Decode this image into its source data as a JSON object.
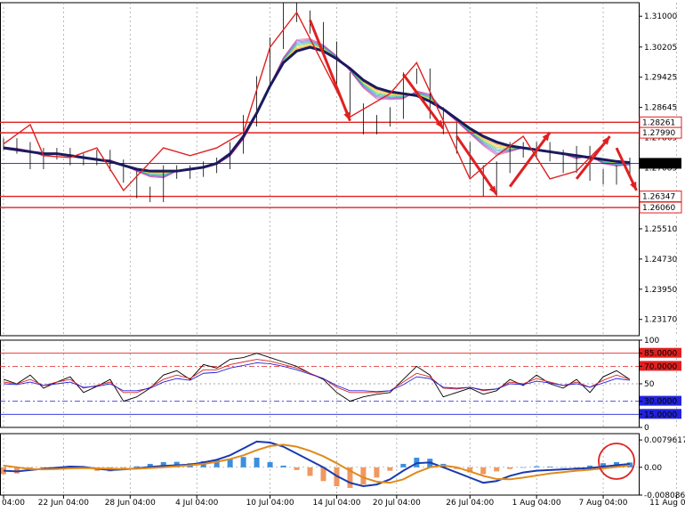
{
  "chart_data": [
    {
      "type": "line",
      "panel": "price",
      "ylim": [
        1.2275,
        1.3135
      ],
      "y_ticks": [
        "1.31000",
        "1.30205",
        "1.29425",
        "1.28645",
        "1.27865",
        "1.27085",
        "1.26305",
        "1.25510",
        "1.24730",
        "1.23950",
        "1.23170"
      ],
      "current_price": "1.27201",
      "current_price_value": 1.27201,
      "level_labels": [
        "1.28261",
        "1.27990",
        "1.26347",
        "1.26060"
      ],
      "levels": [
        1.28261,
        1.2799,
        1.26347,
        1.2606
      ],
      "series": [
        {
          "name": "price",
          "color": "#000000",
          "values": [
            1.277,
            1.276,
            1.272,
            1.2745,
            1.2745,
            1.273,
            1.273,
            1.274,
            1.2715,
            1.2685,
            1.2645,
            1.2635,
            1.27,
            1.2695,
            1.27,
            1.271,
            1.272,
            1.276,
            1.283,
            1.293,
            1.303,
            1.312,
            1.31,
            1.307,
            1.302,
            1.294,
            1.286,
            1.281,
            1.283,
            1.285,
            1.294,
            1.295,
            1.285,
            1.281,
            1.276,
            1.27,
            1.265,
            1.271,
            1.276,
            1.275,
            1.276,
            1.274,
            1.271,
            1.275,
            1.269,
            1.268,
            1.27,
            1.272
          ]
        },
        {
          "name": "MA",
          "color": "#1a1a5e",
          "values": [
            1.276,
            1.2755,
            1.275,
            1.2745,
            1.2745,
            1.274,
            1.2735,
            1.273,
            1.2725,
            1.2715,
            1.2705,
            1.27,
            1.27,
            1.27,
            1.2705,
            1.271,
            1.272,
            1.2745,
            1.279,
            1.285,
            1.292,
            1.298,
            1.301,
            1.302,
            1.301,
            1.299,
            1.2965,
            1.2935,
            1.2915,
            1.2905,
            1.29,
            1.2895,
            1.288,
            1.286,
            1.2835,
            1.281,
            1.279,
            1.2775,
            1.2765,
            1.276,
            1.2755,
            1.275,
            1.2745,
            1.274,
            1.2735,
            1.273,
            1.2725,
            1.2722
          ]
        }
      ]
    },
    {
      "type": "line",
      "panel": "RSI",
      "ylim": [
        0,
        100
      ],
      "y_ticks": [
        "100",
        "85.0000",
        "70.0000",
        "50",
        "30.0000",
        "15.0000",
        "0"
      ],
      "levels": [
        85,
        70,
        50,
        30,
        15
      ],
      "series": [
        {
          "name": "fast",
          "color": "#000000",
          "values": [
            55,
            50,
            60,
            45,
            52,
            58,
            40,
            47,
            55,
            30,
            35,
            45,
            60,
            65,
            55,
            72,
            68,
            78,
            80,
            85,
            80,
            75,
            70,
            62,
            55,
            40,
            30,
            35,
            38,
            40,
            55,
            70,
            60,
            35,
            40,
            45,
            38,
            42,
            55,
            48,
            60,
            50,
            45,
            55,
            40,
            58,
            65,
            55
          ]
        },
        {
          "name": "mid",
          "color": "#dd2222",
          "values": [
            52,
            50,
            55,
            48,
            52,
            55,
            45,
            48,
            52,
            40,
            40,
            46,
            55,
            60,
            56,
            66,
            66,
            72,
            75,
            78,
            76,
            72,
            68,
            62,
            56,
            46,
            40,
            40,
            40,
            42,
            52,
            62,
            58,
            45,
            44,
            46,
            42,
            44,
            52,
            50,
            56,
            52,
            48,
            52,
            46,
            54,
            60,
            55
          ]
        },
        {
          "name": "slow",
          "color": "#2222dd",
          "values": [
            50,
            49,
            52,
            48,
            50,
            52,
            46,
            47,
            50,
            42,
            42,
            45,
            52,
            56,
            54,
            62,
            63,
            68,
            71,
            74,
            73,
            70,
            66,
            61,
            56,
            48,
            42,
            42,
            41,
            42,
            49,
            58,
            56,
            46,
            45,
            46,
            43,
            44,
            50,
            49,
            53,
            51,
            48,
            50,
            46,
            51,
            56,
            54
          ]
        }
      ]
    },
    {
      "type": "bar",
      "panel": "MACD",
      "ylim": [
        -0.0080865,
        0.0098
      ],
      "y_ticks": [
        "0.0079617",
        "0.00",
        "-0.0080865"
      ],
      "histogram": [
        -0.002,
        -0.0018,
        -0.001,
        -0.0005,
        0.0,
        0.0004,
        0.0002,
        -0.001,
        -0.0012,
        -0.0005,
        0.0003,
        0.001,
        0.0015,
        0.0016,
        0.0012,
        0.0018,
        0.0022,
        0.0025,
        0.003,
        0.0028,
        0.0015,
        0.0005,
        -0.0008,
        -0.0025,
        -0.004,
        -0.0055,
        -0.006,
        -0.005,
        -0.003,
        -0.001,
        0.001,
        0.0028,
        0.0025,
        0.001,
        -0.0005,
        -0.0015,
        -0.002,
        -0.0012,
        -0.0005,
        0.0,
        0.0003,
        0.0002,
        0.0,
        -0.0002,
        0.0005,
        0.0012,
        0.0015,
        0.0014
      ],
      "series": [
        {
          "name": "MACD",
          "color": "#1a3ab0",
          "values": [
            -0.001,
            -0.0012,
            -0.0008,
            -0.0004,
            -0.0001,
            0.0002,
            0.0001,
            -0.0004,
            -0.0008,
            -0.0006,
            -0.0003,
            0.0001,
            0.0004,
            0.0006,
            0.0008,
            0.0014,
            0.0022,
            0.0035,
            0.0055,
            0.0075,
            0.0072,
            0.006,
            0.004,
            0.002,
            0.0,
            -0.0025,
            -0.0045,
            -0.0055,
            -0.005,
            -0.0035,
            -0.001,
            0.0012,
            0.0014,
            0.0,
            -0.0015,
            -0.003,
            -0.0045,
            -0.004,
            -0.0025,
            -0.0015,
            -0.001,
            -0.0008,
            -0.0006,
            -0.0004,
            -0.0002,
            0.0002,
            0.0006,
            0.001
          ]
        },
        {
          "name": "Signal",
          "color": "#e08a1c",
          "values": [
            0.0005,
            0.0,
            -0.0005,
            -0.0006,
            -0.0005,
            -0.0003,
            -0.0002,
            -0.0003,
            -0.0004,
            -0.0005,
            -0.0004,
            -0.0002,
            0.0,
            0.0003,
            0.0006,
            0.001,
            0.0016,
            0.0024,
            0.0035,
            0.005,
            0.0062,
            0.0066,
            0.006,
            0.0048,
            0.0032,
            0.0012,
            -0.001,
            -0.003,
            -0.0042,
            -0.0045,
            -0.0035,
            -0.0015,
            0.0,
            0.0005,
            0.0,
            -0.0012,
            -0.0025,
            -0.0034,
            -0.0035,
            -0.003,
            -0.0024,
            -0.0018,
            -0.0014,
            -0.001,
            -0.0007,
            -0.0003,
            0.0001,
            0.0005
          ]
        }
      ]
    }
  ],
  "x_axis": {
    "labels": [
      "04:00",
      "22 Jun 04:00",
      "28 Jun 04:00",
      "4 Jul 04:00",
      "10 Jul 04:00",
      "14 Jul 04:00",
      "20 Jul 04:00",
      "26 Jul 04:00",
      "1 Aug 04:00",
      "7 Aug 04:00",
      "11 Aug 04:00"
    ],
    "label_index": [
      0,
      4.5,
      9.5,
      14.5,
      20,
      25,
      29.5,
      35,
      40,
      45,
      50.5
    ]
  },
  "zigzag_points": [
    [
      0,
      1.277
    ],
    [
      2,
      1.282
    ],
    [
      3,
      1.274
    ],
    [
      5,
      1.2735
    ],
    [
      7,
      1.276
    ],
    [
      9,
      1.265
    ],
    [
      12,
      1.276
    ],
    [
      14,
      1.274
    ],
    [
      16,
      1.276
    ],
    [
      18,
      1.28
    ],
    [
      20,
      1.302
    ],
    [
      22,
      1.311
    ],
    [
      26,
      1.284
    ],
    [
      29,
      1.29
    ],
    [
      31,
      1.298
    ],
    [
      33,
      1.283
    ],
    [
      35,
      1.268
    ],
    [
      37,
      1.274
    ],
    [
      39,
      1.279
    ],
    [
      41,
      1.268
    ],
    [
      43,
      1.27
    ],
    [
      45,
      1.277
    ]
  ],
  "arrows": [
    [
      23,
      1.309,
      26,
      1.283
    ],
    [
      30,
      1.295,
      33,
      1.281
    ],
    [
      34,
      1.279,
      37,
      1.264
    ],
    [
      38,
      1.266,
      41,
      1.28
    ],
    [
      43,
      1.268,
      45.5,
      1.279
    ],
    [
      46,
      1.276,
      47.5,
      1.265
    ]
  ],
  "colors": {
    "level_line": "#e02020",
    "price_line": "#1a2aa0",
    "grid": "#9a9a9a",
    "zigzag": "#e02020",
    "hist_up": "#3a8fe0",
    "hist_down": "#f09860"
  }
}
